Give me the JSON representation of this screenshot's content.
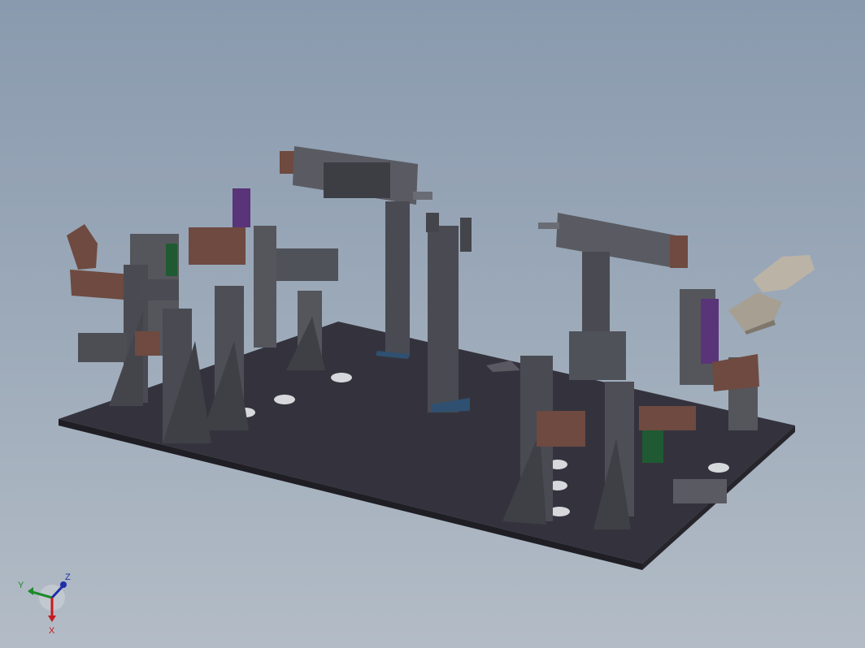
{
  "viewport": {
    "background_top": "#8a9aae",
    "background_bottom": "#b3bcc6"
  },
  "model": {
    "plate_color": "#34333d",
    "steel_color": "#4a4b52",
    "copper_color": "#6e4a40",
    "purple_color": "#5a3478",
    "green_color": "#1f5a32",
    "loose_part_color": "#a79f92"
  },
  "triad": {
    "x_label": "X",
    "y_label": "Y",
    "z_label": "Z",
    "x_color": "#c8191f",
    "y_color": "#1c8a2a",
    "z_color": "#1e2ea8",
    "icon": "view-orientation-triad-icon"
  }
}
